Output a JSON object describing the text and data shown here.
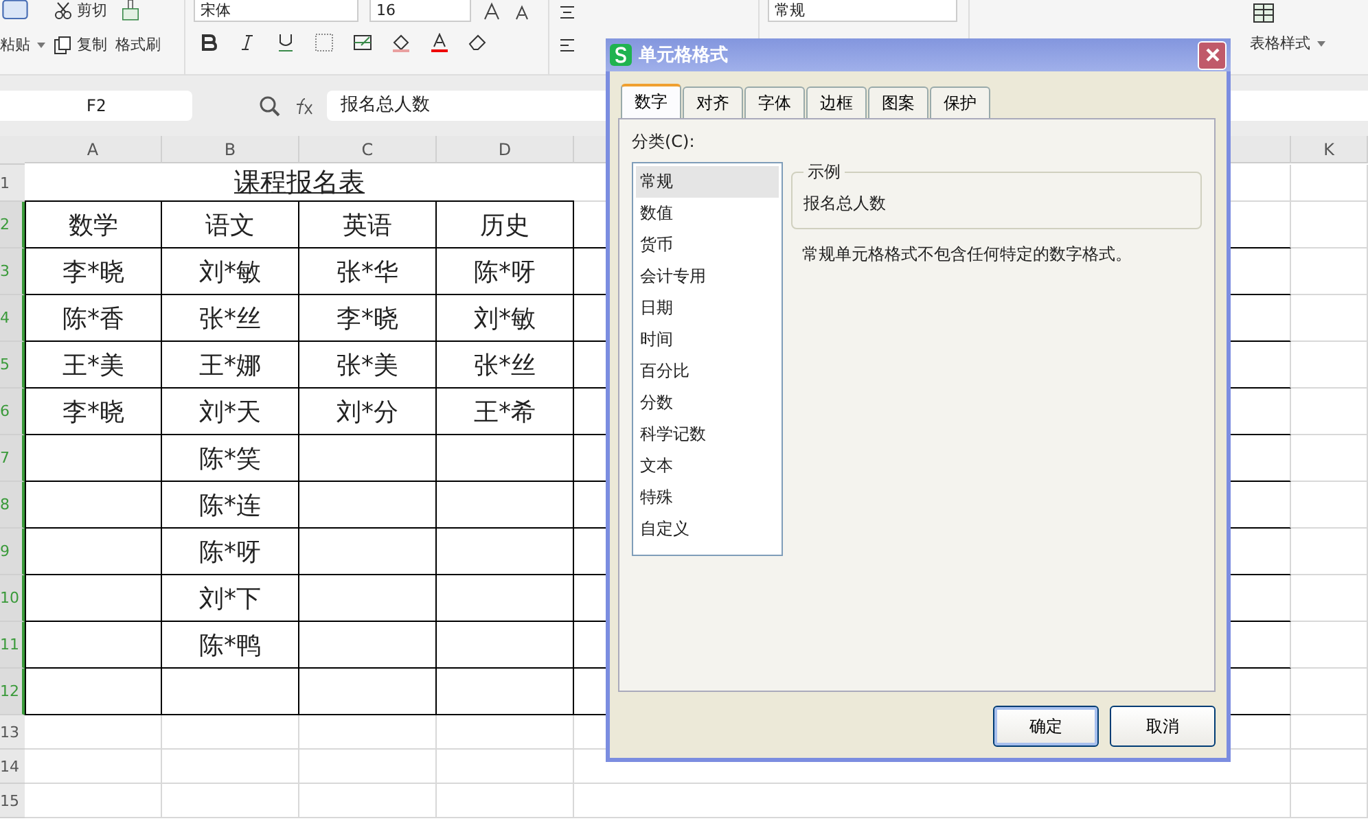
{
  "ribbon": {
    "paste": "粘贴",
    "cut": "剪切",
    "copy": "复制",
    "format_painter": "格式刷",
    "font_name": "宋体",
    "font_size": "16",
    "number_format": "常规",
    "table_style": "表格样式"
  },
  "formula_bar": {
    "cell_ref": "F2",
    "value": "报名总人数"
  },
  "columns": [
    "A",
    "B",
    "C",
    "D",
    "K"
  ],
  "rows": [
    {
      "label": "1",
      "selected": false,
      "title": "课程报名表"
    },
    {
      "label": "2",
      "selected": true,
      "cells": [
        "数学",
        "语文",
        "英语",
        "历史"
      ]
    },
    {
      "label": "3",
      "selected": true,
      "cells": [
        "李*晓",
        "刘*敏",
        "张*华",
        "陈*呀"
      ]
    },
    {
      "label": "4",
      "selected": true,
      "cells": [
        "陈*香",
        "张*丝",
        "李*晓",
        "刘*敏"
      ]
    },
    {
      "label": "5",
      "selected": true,
      "cells": [
        "王*美",
        "王*娜",
        "张*美",
        "张*丝"
      ]
    },
    {
      "label": "6",
      "selected": true,
      "cells": [
        "李*晓",
        "刘*天",
        "刘*分",
        "王*希"
      ]
    },
    {
      "label": "7",
      "selected": true,
      "cells": [
        null,
        "陈*笑",
        null,
        null
      ]
    },
    {
      "label": "8",
      "selected": true,
      "cells": [
        null,
        "陈*连",
        null,
        null
      ]
    },
    {
      "label": "9",
      "selected": true,
      "cells": [
        null,
        "陈*呀",
        null,
        null
      ]
    },
    {
      "label": "10",
      "selected": true,
      "cells": [
        null,
        "刘*下",
        null,
        null
      ]
    },
    {
      "label": "11",
      "selected": true,
      "cells": [
        null,
        "陈*鸭",
        null,
        null
      ]
    },
    {
      "label": "12",
      "selected": true,
      "cells": [
        null,
        null,
        null,
        null
      ]
    },
    {
      "label": "13",
      "selected": false
    },
    {
      "label": "14",
      "selected": false
    },
    {
      "label": "15",
      "selected": false
    }
  ],
  "dialog": {
    "title": "单元格格式",
    "tabs": [
      {
        "label": "数字",
        "selected": true
      },
      {
        "label": "对齐",
        "selected": false
      },
      {
        "label": "字体",
        "selected": false
      },
      {
        "label": "边框",
        "selected": false
      },
      {
        "label": "图案",
        "selected": false
      },
      {
        "label": "保护",
        "selected": false
      }
    ],
    "category_label": "分类(C):",
    "categories": [
      {
        "label": "常规",
        "selected": true
      },
      {
        "label": "数值",
        "selected": false
      },
      {
        "label": "货币",
        "selected": false
      },
      {
        "label": "会计专用",
        "selected": false
      },
      {
        "label": "日期",
        "selected": false
      },
      {
        "label": "时间",
        "selected": false
      },
      {
        "label": "百分比",
        "selected": false
      },
      {
        "label": "分数",
        "selected": false
      },
      {
        "label": "科学记数",
        "selected": false
      },
      {
        "label": "文本",
        "selected": false
      },
      {
        "label": "特殊",
        "selected": false
      },
      {
        "label": "自定义",
        "selected": false
      }
    ],
    "sample_label": "示例",
    "sample_value": "报名总人数",
    "description": "常规单元格格式不包含任何特定的数字格式。",
    "buttons": [
      "确定",
      "取消"
    ]
  }
}
